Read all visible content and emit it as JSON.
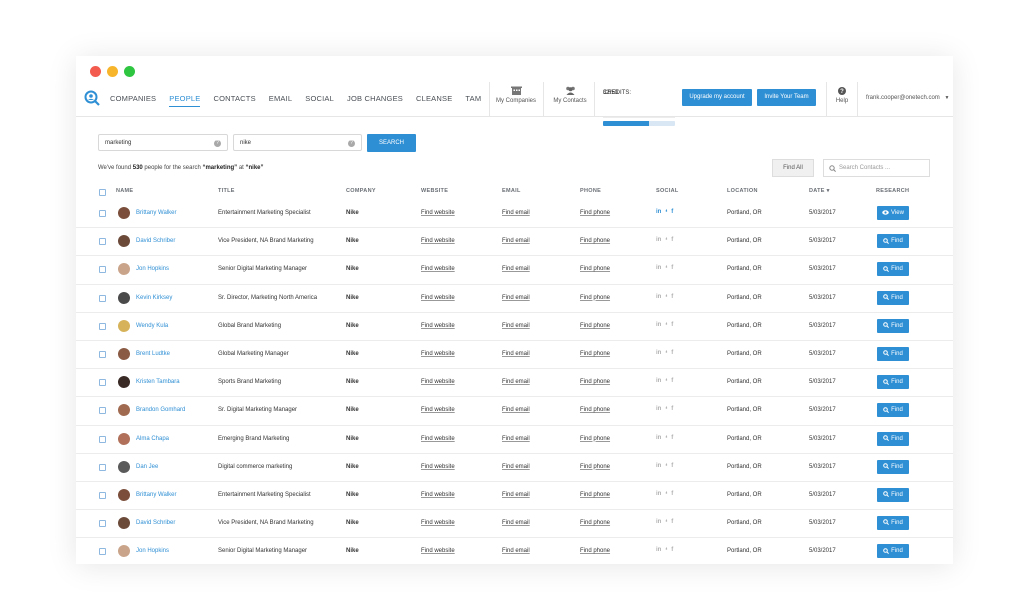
{
  "window": {
    "dot_colors": [
      "#f25b4d",
      "#f7b52c",
      "#2ec541"
    ]
  },
  "nav": {
    "items": [
      "COMPANIES",
      "PEOPLE",
      "CONTACTS",
      "EMAIL",
      "SOCIAL",
      "JOB CHANGES",
      "CLEANSE",
      "TAM"
    ],
    "active": "PEOPLE"
  },
  "header": {
    "my_companies": "My Companies",
    "my_contacts": "My Contacts",
    "credits_label": "CREDITS:",
    "credits_value": "32/50",
    "credits_fraction": 0.64,
    "upgrade_label": "Upgrade my account",
    "invite_label": "Invite Your Team",
    "help_label": "Help",
    "user_email": "frank.cooper@onetech.com"
  },
  "search": {
    "keyword": "marketing",
    "company": "nike",
    "button_label": "SEARCH",
    "result_prefix": "We've found",
    "result_count": "530",
    "result_mid": "people for the search",
    "result_query": "“marketing”",
    "result_at": "at",
    "result_company": "“nike”",
    "find_all_label": "Find All",
    "contacts_placeholder": "Search Contacts ..."
  },
  "table": {
    "headers": {
      "name": "NAME",
      "title": "TITLE",
      "company": "COMPANY",
      "website": "WEBSITE",
      "email": "EMAIL",
      "phone": "PHONE",
      "social": "SOCIAL",
      "location": "LOCATION",
      "date": "DATE ▾",
      "research": "RESEARCH"
    },
    "social_icons": {
      "linkedin": "in",
      "twitter": "❛",
      "facebook": "f"
    },
    "rows": [
      {
        "name": "Brittany Walker",
        "title": "Entertainment Marketing Specialist",
        "company": "Nike",
        "website": "Find website",
        "email": "Find email",
        "phone": "Find phone",
        "location": "Portland, OR",
        "date": "5/03/2017",
        "action": "View",
        "social_active": true,
        "avatar_color": "#7a4e3a"
      },
      {
        "name": "David Schriber",
        "title": "Vice President, NA Brand Marketing",
        "company": "Nike",
        "website": "Find website",
        "email": "Find email",
        "phone": "Find phone",
        "location": "Portland, OR",
        "date": "5/03/2017",
        "action": "Find",
        "social_active": false,
        "avatar_color": "#6b4a3a"
      },
      {
        "name": "Jon Hopkins",
        "title": "Senior Digital Marketing Manager",
        "company": "Nike",
        "website": "Find website",
        "email": "Find email",
        "phone": "Find phone",
        "location": "Portland, OR",
        "date": "5/03/2017",
        "action": "Find",
        "social_active": false,
        "avatar_color": "#c9a48a"
      },
      {
        "name": "Kevin Kirksey",
        "title": "Sr. Director, Marketing North America",
        "company": "Nike",
        "website": "Find website",
        "email": "Find email",
        "phone": "Find phone",
        "location": "Portland, OR",
        "date": "5/03/2017",
        "action": "Find",
        "social_active": false,
        "avatar_color": "#4a4a4a"
      },
      {
        "name": "Wendy Kula",
        "title": "Global Brand Marketing",
        "company": "Nike",
        "website": "Find website",
        "email": "Find email",
        "phone": "Find phone",
        "location": "Portland, OR",
        "date": "5/03/2017",
        "action": "Find",
        "social_active": false,
        "avatar_color": "#d6b35a"
      },
      {
        "name": "Brent Ludtke",
        "title": "Global Marketing Manager",
        "company": "Nike",
        "website": "Find website",
        "email": "Find email",
        "phone": "Find phone",
        "location": "Portland, OR",
        "date": "5/03/2017",
        "action": "Find",
        "social_active": false,
        "avatar_color": "#8a5a44"
      },
      {
        "name": "Kristen Tambara",
        "title": "Sports Brand Marketing",
        "company": "Nike",
        "website": "Find website",
        "email": "Find email",
        "phone": "Find phone",
        "location": "Portland, OR",
        "date": "5/03/2017",
        "action": "Find",
        "social_active": false,
        "avatar_color": "#3a2a26"
      },
      {
        "name": "Brandon Gomhard",
        "title": "Sr. Digital Marketing Manager",
        "company": "Nike",
        "website": "Find website",
        "email": "Find email",
        "phone": "Find phone",
        "location": "Portland, OR",
        "date": "5/03/2017",
        "action": "Find",
        "social_active": false,
        "avatar_color": "#a06a50"
      },
      {
        "name": "Alma Chapa",
        "title": "Emerging Brand Marketing",
        "company": "Nike",
        "website": "Find website",
        "email": "Find email",
        "phone": "Find phone",
        "location": "Portland, OR",
        "date": "5/03/2017",
        "action": "Find",
        "social_active": false,
        "avatar_color": "#b0705a"
      },
      {
        "name": "Dan Jee",
        "title": "Digital commerce marketing",
        "company": "Nike",
        "website": "Find website",
        "email": "Find email",
        "phone": "Find phone",
        "location": "Portland, OR",
        "date": "5/03/2017",
        "action": "Find",
        "social_active": false,
        "avatar_color": "#5a5a5a"
      },
      {
        "name": "Brittany Walker",
        "title": "Entertainment Marketing Specialist",
        "company": "Nike",
        "website": "Find website",
        "email": "Find email",
        "phone": "Find phone",
        "location": "Portland, OR",
        "date": "5/03/2017",
        "action": "Find",
        "social_active": false,
        "avatar_color": "#7a4e3a"
      },
      {
        "name": "David Schriber",
        "title": "Vice President, NA Brand Marketing",
        "company": "Nike",
        "website": "Find website",
        "email": "Find email",
        "phone": "Find phone",
        "location": "Portland, OR",
        "date": "5/03/2017",
        "action": "Find",
        "social_active": false,
        "avatar_color": "#6b4a3a"
      },
      {
        "name": "Jon Hopkins",
        "title": "Senior Digital Marketing Manager",
        "company": "Nike",
        "website": "Find website",
        "email": "Find email",
        "phone": "Find phone",
        "location": "Portland, OR",
        "date": "5/03/2017",
        "action": "Find",
        "social_active": false,
        "avatar_color": "#c9a48a"
      },
      {
        "name": "",
        "title": "",
        "company": "",
        "website": "",
        "email": "",
        "phone": "",
        "location": "",
        "date": "",
        "action": "",
        "social_active": false,
        "avatar_color": "#c9a48a"
      }
    ]
  }
}
